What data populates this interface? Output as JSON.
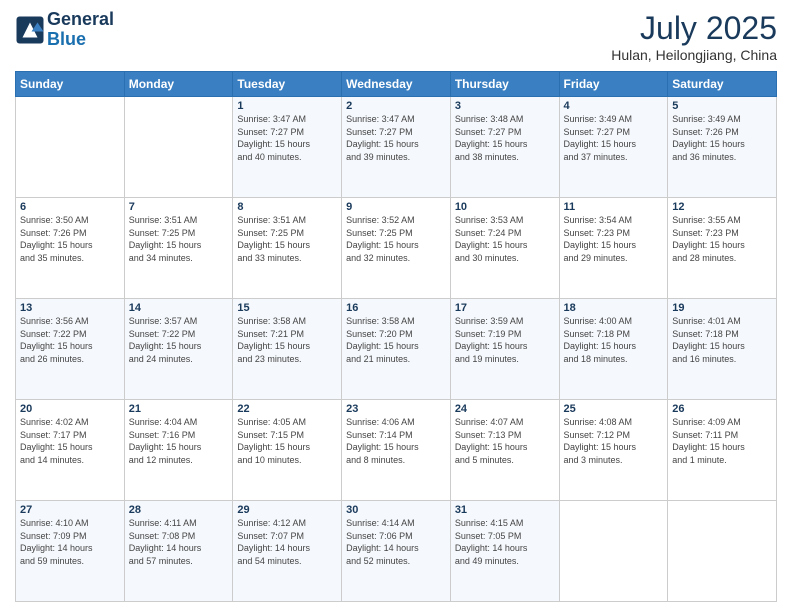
{
  "header": {
    "logo_line1": "General",
    "logo_line2": "Blue",
    "month_title": "July 2025",
    "location": "Hulan, Heilongjiang, China"
  },
  "weekdays": [
    "Sunday",
    "Monday",
    "Tuesday",
    "Wednesday",
    "Thursday",
    "Friday",
    "Saturday"
  ],
  "weeks": [
    [
      {
        "day": "",
        "info": ""
      },
      {
        "day": "",
        "info": ""
      },
      {
        "day": "1",
        "info": "Sunrise: 3:47 AM\nSunset: 7:27 PM\nDaylight: 15 hours\nand 40 minutes."
      },
      {
        "day": "2",
        "info": "Sunrise: 3:47 AM\nSunset: 7:27 PM\nDaylight: 15 hours\nand 39 minutes."
      },
      {
        "day": "3",
        "info": "Sunrise: 3:48 AM\nSunset: 7:27 PM\nDaylight: 15 hours\nand 38 minutes."
      },
      {
        "day": "4",
        "info": "Sunrise: 3:49 AM\nSunset: 7:27 PM\nDaylight: 15 hours\nand 37 minutes."
      },
      {
        "day": "5",
        "info": "Sunrise: 3:49 AM\nSunset: 7:26 PM\nDaylight: 15 hours\nand 36 minutes."
      }
    ],
    [
      {
        "day": "6",
        "info": "Sunrise: 3:50 AM\nSunset: 7:26 PM\nDaylight: 15 hours\nand 35 minutes."
      },
      {
        "day": "7",
        "info": "Sunrise: 3:51 AM\nSunset: 7:25 PM\nDaylight: 15 hours\nand 34 minutes."
      },
      {
        "day": "8",
        "info": "Sunrise: 3:51 AM\nSunset: 7:25 PM\nDaylight: 15 hours\nand 33 minutes."
      },
      {
        "day": "9",
        "info": "Sunrise: 3:52 AM\nSunset: 7:25 PM\nDaylight: 15 hours\nand 32 minutes."
      },
      {
        "day": "10",
        "info": "Sunrise: 3:53 AM\nSunset: 7:24 PM\nDaylight: 15 hours\nand 30 minutes."
      },
      {
        "day": "11",
        "info": "Sunrise: 3:54 AM\nSunset: 7:23 PM\nDaylight: 15 hours\nand 29 minutes."
      },
      {
        "day": "12",
        "info": "Sunrise: 3:55 AM\nSunset: 7:23 PM\nDaylight: 15 hours\nand 28 minutes."
      }
    ],
    [
      {
        "day": "13",
        "info": "Sunrise: 3:56 AM\nSunset: 7:22 PM\nDaylight: 15 hours\nand 26 minutes."
      },
      {
        "day": "14",
        "info": "Sunrise: 3:57 AM\nSunset: 7:22 PM\nDaylight: 15 hours\nand 24 minutes."
      },
      {
        "day": "15",
        "info": "Sunrise: 3:58 AM\nSunset: 7:21 PM\nDaylight: 15 hours\nand 23 minutes."
      },
      {
        "day": "16",
        "info": "Sunrise: 3:58 AM\nSunset: 7:20 PM\nDaylight: 15 hours\nand 21 minutes."
      },
      {
        "day": "17",
        "info": "Sunrise: 3:59 AM\nSunset: 7:19 PM\nDaylight: 15 hours\nand 19 minutes."
      },
      {
        "day": "18",
        "info": "Sunrise: 4:00 AM\nSunset: 7:18 PM\nDaylight: 15 hours\nand 18 minutes."
      },
      {
        "day": "19",
        "info": "Sunrise: 4:01 AM\nSunset: 7:18 PM\nDaylight: 15 hours\nand 16 minutes."
      }
    ],
    [
      {
        "day": "20",
        "info": "Sunrise: 4:02 AM\nSunset: 7:17 PM\nDaylight: 15 hours\nand 14 minutes."
      },
      {
        "day": "21",
        "info": "Sunrise: 4:04 AM\nSunset: 7:16 PM\nDaylight: 15 hours\nand 12 minutes."
      },
      {
        "day": "22",
        "info": "Sunrise: 4:05 AM\nSunset: 7:15 PM\nDaylight: 15 hours\nand 10 minutes."
      },
      {
        "day": "23",
        "info": "Sunrise: 4:06 AM\nSunset: 7:14 PM\nDaylight: 15 hours\nand 8 minutes."
      },
      {
        "day": "24",
        "info": "Sunrise: 4:07 AM\nSunset: 7:13 PM\nDaylight: 15 hours\nand 5 minutes."
      },
      {
        "day": "25",
        "info": "Sunrise: 4:08 AM\nSunset: 7:12 PM\nDaylight: 15 hours\nand 3 minutes."
      },
      {
        "day": "26",
        "info": "Sunrise: 4:09 AM\nSunset: 7:11 PM\nDaylight: 15 hours\nand 1 minute."
      }
    ],
    [
      {
        "day": "27",
        "info": "Sunrise: 4:10 AM\nSunset: 7:09 PM\nDaylight: 14 hours\nand 59 minutes."
      },
      {
        "day": "28",
        "info": "Sunrise: 4:11 AM\nSunset: 7:08 PM\nDaylight: 14 hours\nand 57 minutes."
      },
      {
        "day": "29",
        "info": "Sunrise: 4:12 AM\nSunset: 7:07 PM\nDaylight: 14 hours\nand 54 minutes."
      },
      {
        "day": "30",
        "info": "Sunrise: 4:14 AM\nSunset: 7:06 PM\nDaylight: 14 hours\nand 52 minutes."
      },
      {
        "day": "31",
        "info": "Sunrise: 4:15 AM\nSunset: 7:05 PM\nDaylight: 14 hours\nand 49 minutes."
      },
      {
        "day": "",
        "info": ""
      },
      {
        "day": "",
        "info": ""
      }
    ]
  ]
}
